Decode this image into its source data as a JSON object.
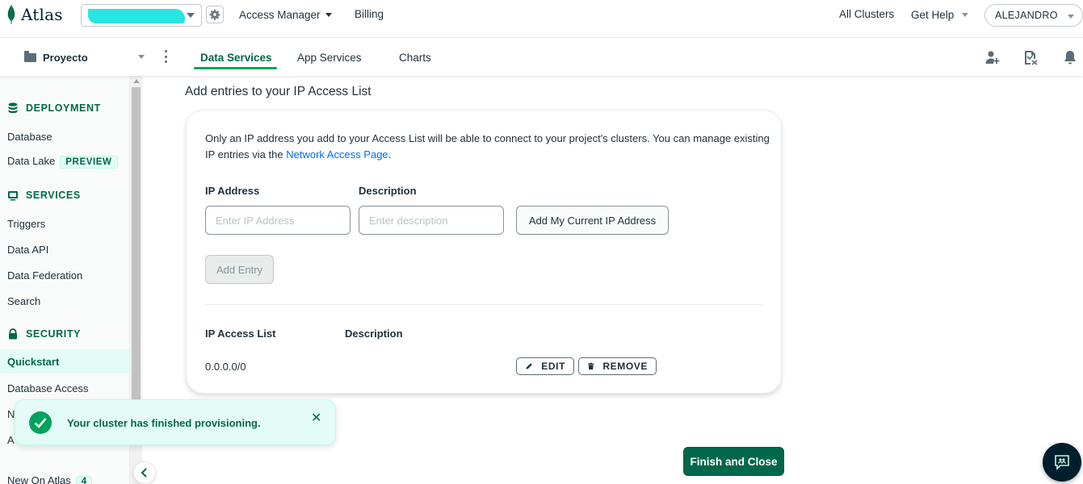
{
  "topbar": {
    "logo_text": "Atlas",
    "org_selector_value": "",
    "nav": {
      "access_manager": "Access Manager",
      "billing": "Billing",
      "all_clusters": "All Clusters",
      "get_help": "Get Help"
    },
    "user": "ALEJANDRO"
  },
  "subbar": {
    "project_name": "Proyecto",
    "tabs": [
      {
        "label": "Data Services",
        "active": true
      },
      {
        "label": "App Services",
        "active": false
      },
      {
        "label": "Charts",
        "active": false
      }
    ]
  },
  "sidebar": {
    "deployment_header": "DEPLOYMENT",
    "database": "Database",
    "data_lake": "Data Lake",
    "data_lake_badge": "PREVIEW",
    "services_header": "SERVICES",
    "triggers": "Triggers",
    "data_api": "Data API",
    "data_federation": "Data Federation",
    "search": "Search",
    "security_header": "SECURITY",
    "quickstart": "Quickstart",
    "database_access": "Database Access",
    "network_partial": "N",
    "advanced_partial": "A",
    "new_on_atlas": "New On Atlas",
    "new_on_atlas_count": "4"
  },
  "main": {
    "title": "Add entries to your IP Access List",
    "desc_text": "Only an IP address you add to your Access List will be able to connect to your project's clusters. You can manage existing IP entries via the",
    "desc_link": "Network Access Page",
    "desc_end": ".",
    "ip_label": "IP Address",
    "ip_placeholder": "Enter IP Address",
    "desc_label": "Description",
    "desc_placeholder": "Enter description",
    "add_current_ip": "Add My Current IP Address",
    "add_entry": "Add Entry",
    "list_header_ip": "IP Access List",
    "list_header_desc": "Description",
    "entries": [
      {
        "ip": "0.0.0.0/0",
        "description": ""
      }
    ],
    "edit_label": "EDIT",
    "remove_label": "REMOVE",
    "finish_button": "Finish and Close"
  },
  "toast": {
    "message": "Your cluster has finished provisioning."
  },
  "colors": {
    "brand_green": "#00684a",
    "accent_green": "#00a35c",
    "link_blue": "#016bf8",
    "toast_bg": "#e3fcf7"
  }
}
